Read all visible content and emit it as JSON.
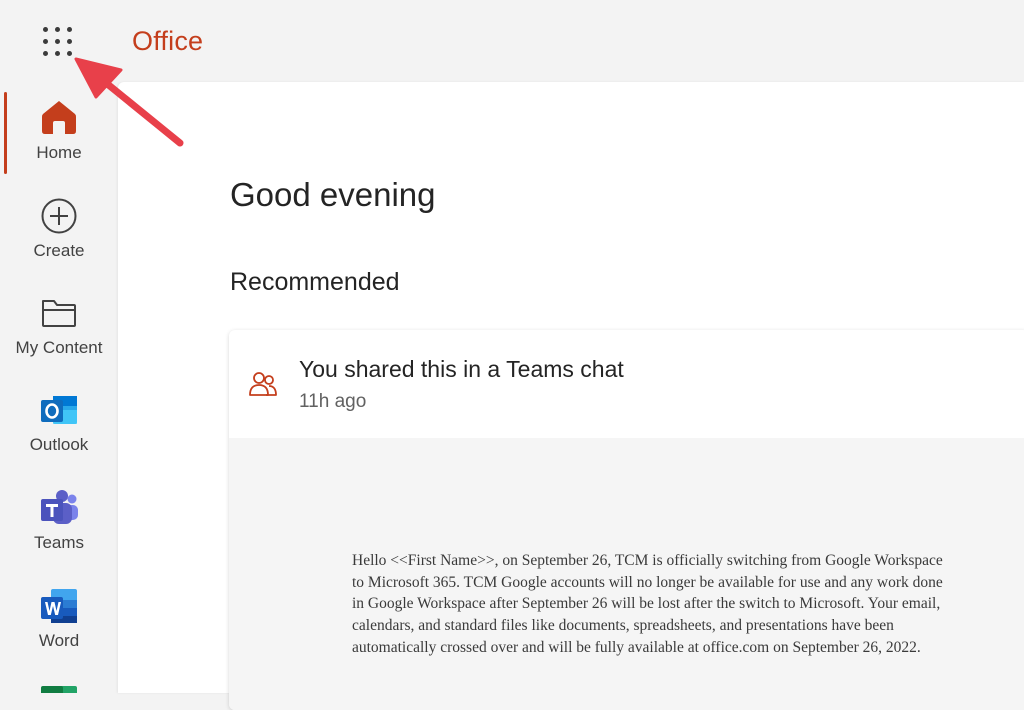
{
  "header": {
    "app_name": "Office"
  },
  "sidebar": {
    "items": [
      {
        "label": "Home"
      },
      {
        "label": "Create"
      },
      {
        "label": "My Content"
      },
      {
        "label": "Outlook"
      },
      {
        "label": "Teams"
      },
      {
        "label": "Word"
      }
    ]
  },
  "main": {
    "greeting": "Good evening",
    "section_title": "Recommended",
    "card": {
      "title": "You shared this in a Teams chat",
      "time": "11h ago",
      "preview_text": "Hello <<First Name>>, on September 26, TCM is officially switching from Google Workspace to Microsoft 365. TCM Google accounts will no longer be available for use and any work done in Google Workspace after September 26 will be lost after the switch to Microsoft. Your email, calendars, and standard files like documents, spreadsheets, and presentations have been automatically crossed over and will be fully available at office.com on September 26, 2022."
    }
  },
  "colors": {
    "accent": "#c43e1c",
    "outlook": "#0f6cbd",
    "teams": "#5b5fc7",
    "word": "#185abd",
    "annotation_arrow": "#e8404a"
  },
  "icons": [
    "app-launcher-icon",
    "home-icon",
    "plus-circle-icon",
    "folder-icon",
    "outlook-icon",
    "teams-icon",
    "word-icon",
    "excel-icon",
    "people-icon"
  ]
}
